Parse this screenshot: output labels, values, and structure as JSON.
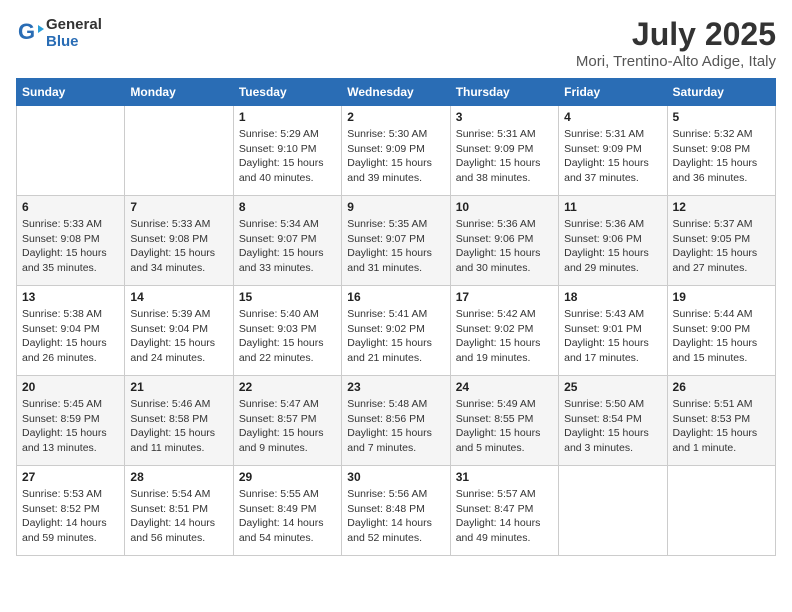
{
  "header": {
    "logo_line1": "General",
    "logo_line2": "Blue",
    "month_year": "July 2025",
    "location": "Mori, Trentino-Alto Adige, Italy"
  },
  "weekdays": [
    "Sunday",
    "Monday",
    "Tuesday",
    "Wednesday",
    "Thursday",
    "Friday",
    "Saturday"
  ],
  "weeks": [
    [
      {
        "day": "",
        "info": ""
      },
      {
        "day": "",
        "info": ""
      },
      {
        "day": "1",
        "info": "Sunrise: 5:29 AM\nSunset: 9:10 PM\nDaylight: 15 hours\nand 40 minutes."
      },
      {
        "day": "2",
        "info": "Sunrise: 5:30 AM\nSunset: 9:09 PM\nDaylight: 15 hours\nand 39 minutes."
      },
      {
        "day": "3",
        "info": "Sunrise: 5:31 AM\nSunset: 9:09 PM\nDaylight: 15 hours\nand 38 minutes."
      },
      {
        "day": "4",
        "info": "Sunrise: 5:31 AM\nSunset: 9:09 PM\nDaylight: 15 hours\nand 37 minutes."
      },
      {
        "day": "5",
        "info": "Sunrise: 5:32 AM\nSunset: 9:08 PM\nDaylight: 15 hours\nand 36 minutes."
      }
    ],
    [
      {
        "day": "6",
        "info": "Sunrise: 5:33 AM\nSunset: 9:08 PM\nDaylight: 15 hours\nand 35 minutes."
      },
      {
        "day": "7",
        "info": "Sunrise: 5:33 AM\nSunset: 9:08 PM\nDaylight: 15 hours\nand 34 minutes."
      },
      {
        "day": "8",
        "info": "Sunrise: 5:34 AM\nSunset: 9:07 PM\nDaylight: 15 hours\nand 33 minutes."
      },
      {
        "day": "9",
        "info": "Sunrise: 5:35 AM\nSunset: 9:07 PM\nDaylight: 15 hours\nand 31 minutes."
      },
      {
        "day": "10",
        "info": "Sunrise: 5:36 AM\nSunset: 9:06 PM\nDaylight: 15 hours\nand 30 minutes."
      },
      {
        "day": "11",
        "info": "Sunrise: 5:36 AM\nSunset: 9:06 PM\nDaylight: 15 hours\nand 29 minutes."
      },
      {
        "day": "12",
        "info": "Sunrise: 5:37 AM\nSunset: 9:05 PM\nDaylight: 15 hours\nand 27 minutes."
      }
    ],
    [
      {
        "day": "13",
        "info": "Sunrise: 5:38 AM\nSunset: 9:04 PM\nDaylight: 15 hours\nand 26 minutes."
      },
      {
        "day": "14",
        "info": "Sunrise: 5:39 AM\nSunset: 9:04 PM\nDaylight: 15 hours\nand 24 minutes."
      },
      {
        "day": "15",
        "info": "Sunrise: 5:40 AM\nSunset: 9:03 PM\nDaylight: 15 hours\nand 22 minutes."
      },
      {
        "day": "16",
        "info": "Sunrise: 5:41 AM\nSunset: 9:02 PM\nDaylight: 15 hours\nand 21 minutes."
      },
      {
        "day": "17",
        "info": "Sunrise: 5:42 AM\nSunset: 9:02 PM\nDaylight: 15 hours\nand 19 minutes."
      },
      {
        "day": "18",
        "info": "Sunrise: 5:43 AM\nSunset: 9:01 PM\nDaylight: 15 hours\nand 17 minutes."
      },
      {
        "day": "19",
        "info": "Sunrise: 5:44 AM\nSunset: 9:00 PM\nDaylight: 15 hours\nand 15 minutes."
      }
    ],
    [
      {
        "day": "20",
        "info": "Sunrise: 5:45 AM\nSunset: 8:59 PM\nDaylight: 15 hours\nand 13 minutes."
      },
      {
        "day": "21",
        "info": "Sunrise: 5:46 AM\nSunset: 8:58 PM\nDaylight: 15 hours\nand 11 minutes."
      },
      {
        "day": "22",
        "info": "Sunrise: 5:47 AM\nSunset: 8:57 PM\nDaylight: 15 hours\nand 9 minutes."
      },
      {
        "day": "23",
        "info": "Sunrise: 5:48 AM\nSunset: 8:56 PM\nDaylight: 15 hours\nand 7 minutes."
      },
      {
        "day": "24",
        "info": "Sunrise: 5:49 AM\nSunset: 8:55 PM\nDaylight: 15 hours\nand 5 minutes."
      },
      {
        "day": "25",
        "info": "Sunrise: 5:50 AM\nSunset: 8:54 PM\nDaylight: 15 hours\nand 3 minutes."
      },
      {
        "day": "26",
        "info": "Sunrise: 5:51 AM\nSunset: 8:53 PM\nDaylight: 15 hours\nand 1 minute."
      }
    ],
    [
      {
        "day": "27",
        "info": "Sunrise: 5:53 AM\nSunset: 8:52 PM\nDaylight: 14 hours\nand 59 minutes."
      },
      {
        "day": "28",
        "info": "Sunrise: 5:54 AM\nSunset: 8:51 PM\nDaylight: 14 hours\nand 56 minutes."
      },
      {
        "day": "29",
        "info": "Sunrise: 5:55 AM\nSunset: 8:49 PM\nDaylight: 14 hours\nand 54 minutes."
      },
      {
        "day": "30",
        "info": "Sunrise: 5:56 AM\nSunset: 8:48 PM\nDaylight: 14 hours\nand 52 minutes."
      },
      {
        "day": "31",
        "info": "Sunrise: 5:57 AM\nSunset: 8:47 PM\nDaylight: 14 hours\nand 49 minutes."
      },
      {
        "day": "",
        "info": ""
      },
      {
        "day": "",
        "info": ""
      }
    ]
  ]
}
